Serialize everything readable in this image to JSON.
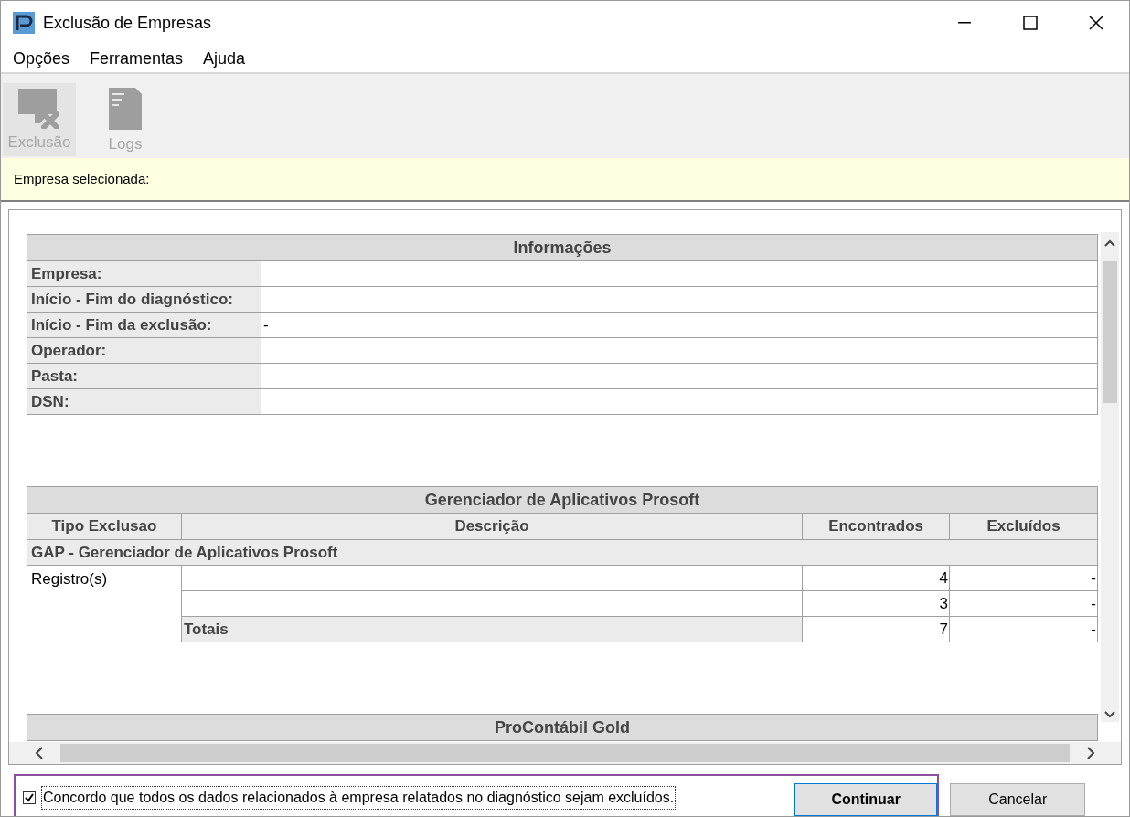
{
  "window": {
    "title": "Exclusão de Empresas"
  },
  "menu": [
    "Opções",
    "Ferramentas",
    "Ajuda"
  ],
  "toolbar": [
    {
      "kind": "delete",
      "label": "Exclusão",
      "disabled": true,
      "selected": true
    },
    {
      "kind": "logs",
      "label": "Logs",
      "disabled": true,
      "selected": false
    }
  ],
  "selected_company": {
    "label": "Empresa selecionada:"
  },
  "info_table": {
    "title": "Informações",
    "rows": [
      {
        "label": "Empresa:",
        "value": ""
      },
      {
        "label": "Início - Fim do diagnóstico:",
        "value": ""
      },
      {
        "label": "Início - Fim da exclusão:",
        "value": "-"
      },
      {
        "label": "Operador:",
        "value": ""
      },
      {
        "label": "Pasta:",
        "value": ""
      },
      {
        "label": "DSN:",
        "value": ""
      }
    ]
  },
  "gap_table": {
    "title": "Gerenciador de Aplicativos Prosoft",
    "columns": [
      "Tipo Exclusao",
      "Descrição",
      "Encontrados",
      "Excluídos"
    ],
    "group": "GAP - Gerenciador de Aplicativos Prosoft",
    "type": "Registro(s)",
    "rows": [
      {
        "kind": "item",
        "label": "",
        "found": "4",
        "deleted": "-"
      },
      {
        "kind": "item",
        "label": "",
        "found": "3",
        "deleted": "-"
      },
      {
        "kind": "total",
        "label": "Totais",
        "found": "7",
        "deleted": "-"
      }
    ]
  },
  "next_table": {
    "title": "ProContábil Gold"
  },
  "agreement": {
    "label": "Concordo que todos os dados relacionados à empresa relatados no diagnóstico sejam excluídos.",
    "checked": true
  },
  "buttons": [
    {
      "label": "Continuar",
      "default": true
    },
    {
      "label": "Cancelar",
      "default": false
    }
  ]
}
